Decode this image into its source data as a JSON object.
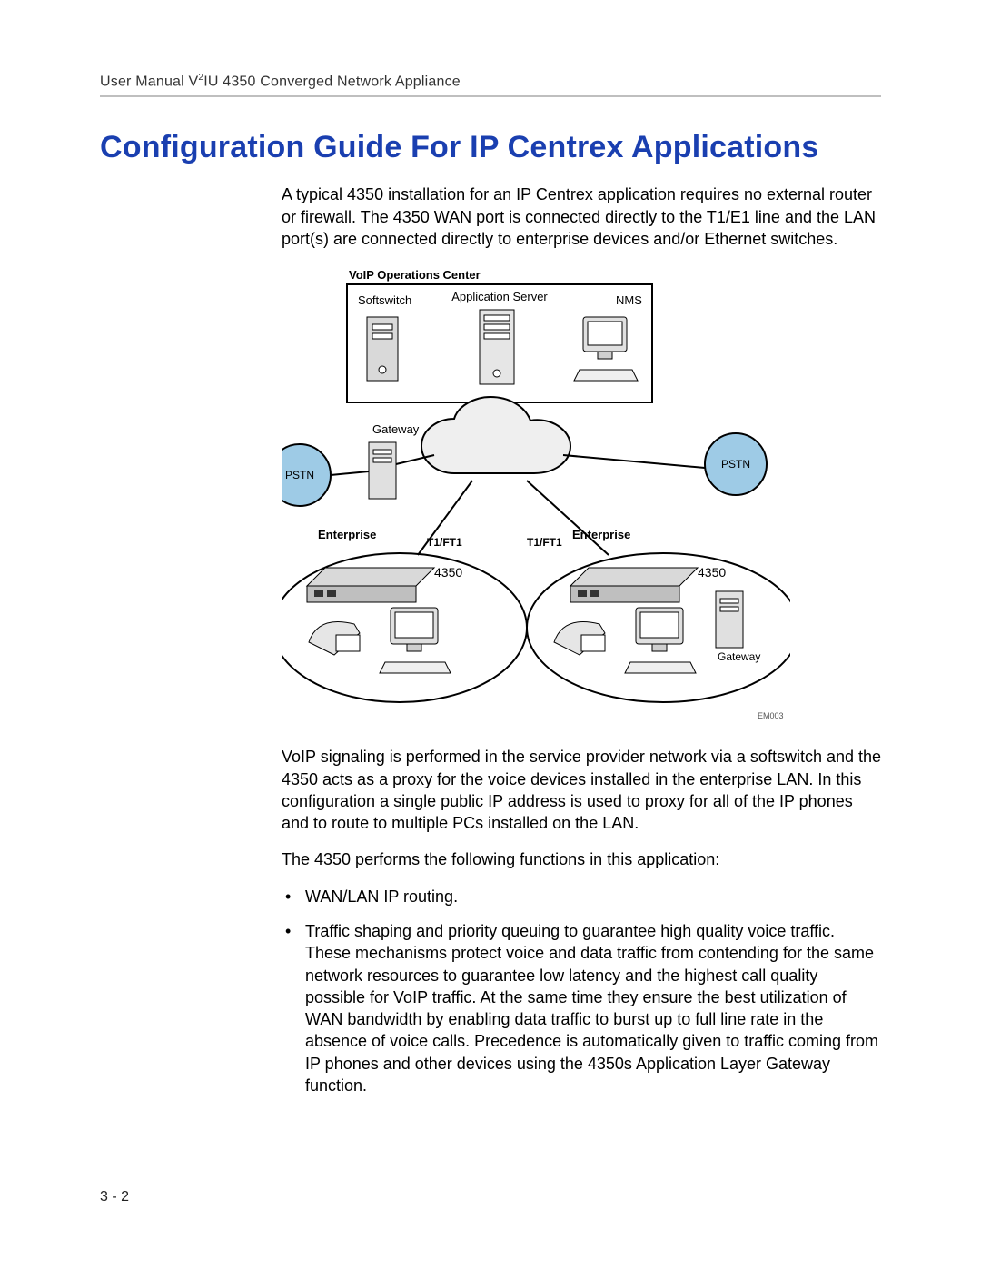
{
  "header": {
    "line_prefix": "User Manual V",
    "line_sup": "2",
    "line_suffix": "IU 4350 Converged Network Appliance"
  },
  "title": "Configuration Guide For IP Centrex Applications",
  "paragraphs": {
    "p1": "A typical 4350 installation for an IP Centrex application requires no external router or firewall. The 4350 WAN port is connected directly to the T1/E1 line and the LAN port(s) are connected directly to enterprise devices and/or Ethernet switches.",
    "p2": "VoIP signaling is performed in the service provider network via a softswitch and the 4350 acts as a proxy for the voice devices installed in the enterprise LAN. In this configuration a single public IP address is used to proxy for all of the IP phones and to route to multiple PCs installed on the LAN.",
    "p3": "The 4350 performs the following functions in this application:"
  },
  "bullets": {
    "b1": "WAN/LAN IP routing.",
    "b2": "Traffic shaping and priority queuing to guarantee high quality voice traffic. These mechanisms protect voice and data traffic from contending for the same network resources to guarantee low latency and the highest call quality possible for VoIP traffic. At the same time they ensure the best utilization of WAN bandwidth by enabling data traffic to burst up to full line rate in the absence of voice calls. Precedence is automatically given to traffic coming from IP phones and other devices using the 4350s Application Layer Gateway function."
  },
  "diagram": {
    "voip_box_title": "VoIP Operations Center",
    "softswitch": "Softswitch",
    "app_server": "Application Server",
    "nms": "NMS",
    "gateway": "Gateway",
    "pstn": "PSTN",
    "t1": "T1",
    "t1ft1": "T1/FT1",
    "enterprise": "Enterprise",
    "device4350": "4350",
    "figure_ref": "EM003"
  },
  "footer": {
    "page_number": "3 - 2"
  }
}
